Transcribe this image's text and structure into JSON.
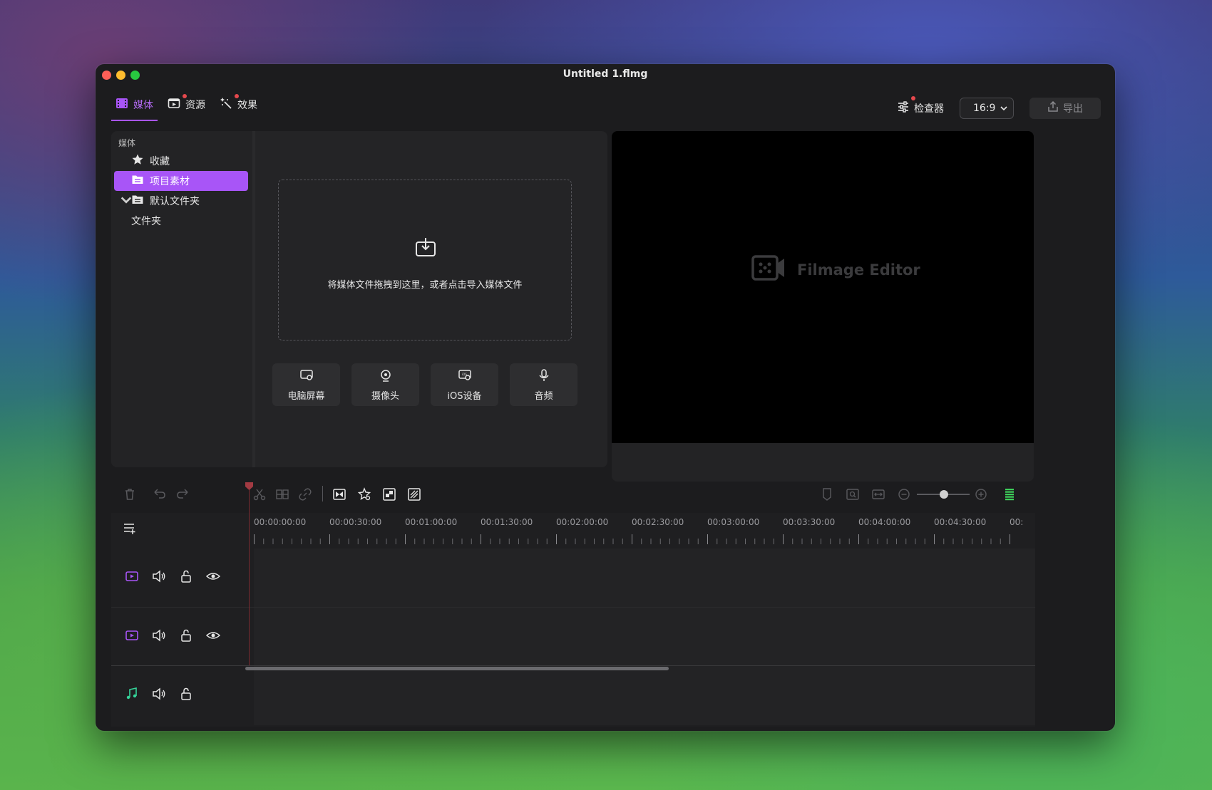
{
  "window": {
    "title": "Untitled 1.flmg"
  },
  "tabs": [
    {
      "label": "媒体",
      "icon": "film-icon",
      "active": true,
      "badge": false
    },
    {
      "label": "资源",
      "icon": "resources-icon",
      "active": false,
      "badge": true
    },
    {
      "label": "效果",
      "icon": "magic-wand-icon",
      "active": false,
      "badge": true
    }
  ],
  "header": {
    "inspector_label": "检查器",
    "aspect_ratio": "16:9",
    "export_label": "导出"
  },
  "sidebar": {
    "title": "媒体",
    "items": [
      {
        "label": "收藏",
        "icon": "star-icon"
      },
      {
        "label": "项目素材",
        "icon": "folder-icon",
        "active": true
      },
      {
        "label": "默认文件夹",
        "icon": "folder-icon",
        "expanded": true
      },
      {
        "label": "文件夹",
        "icon": ""
      }
    ]
  },
  "media": {
    "drop_text": "将媒体文件拖拽到这里，或者点击导入媒体文件",
    "record_buttons": [
      {
        "label": "电脑屏幕",
        "icon": "screen-record-icon"
      },
      {
        "label": "摄像头",
        "icon": "webcam-icon"
      },
      {
        "label": "iOS设备",
        "icon": "ios-device-icon"
      },
      {
        "label": "音频",
        "icon": "microphone-icon"
      }
    ]
  },
  "preview": {
    "logo_text": "Filmage Editor"
  },
  "timeline": {
    "ruler_labels": [
      "00:00:00:00",
      "00:00:30:00",
      "00:01:00:00",
      "00:01:30:00",
      "00:02:00:00",
      "00:02:30:00",
      "00:03:00:00",
      "00:03:30:00",
      "00:04:00:00",
      "00:04:30:00",
      "00:"
    ],
    "tracks": [
      {
        "type": "video",
        "icon": "video-track-icon"
      },
      {
        "type": "video",
        "icon": "video-track-icon"
      },
      {
        "type": "audio",
        "icon": "music-note-icon"
      }
    ]
  },
  "colors": {
    "accent": "#a855f7",
    "badge": "#e5484d",
    "audio_track": "#34d399"
  }
}
